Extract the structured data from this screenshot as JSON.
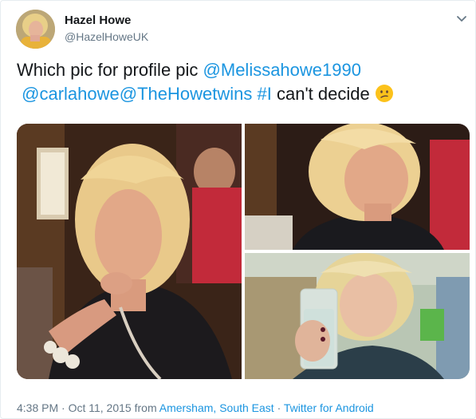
{
  "author": {
    "display_name": "Hazel Howe",
    "handle": "@HazelHoweUK"
  },
  "tweet": {
    "text_before": "Which pic for profile pic ",
    "mention_1": "@Melissahowe1990",
    "mention_2": "@carlahowe",
    "mention_3": "@TheHowetwins",
    "hashtag": "#I",
    "text_after": " can't decide"
  },
  "photos": [
    {
      "name": "photo-1"
    },
    {
      "name": "photo-2"
    },
    {
      "name": "photo-3"
    }
  ],
  "meta": {
    "timestamp": "4:38 PM · Oct 11, 2015",
    "from_prefix": " from ",
    "location": "Amersham, South East",
    "separator": " · ",
    "source": "Twitter for Android"
  },
  "colors": {
    "link": "#1b95e0",
    "secondary_text": "#657786",
    "primary_text": "#14171a"
  },
  "icons": {
    "emoji": "confused-face-emoji",
    "caret": "chevron-down-icon"
  }
}
